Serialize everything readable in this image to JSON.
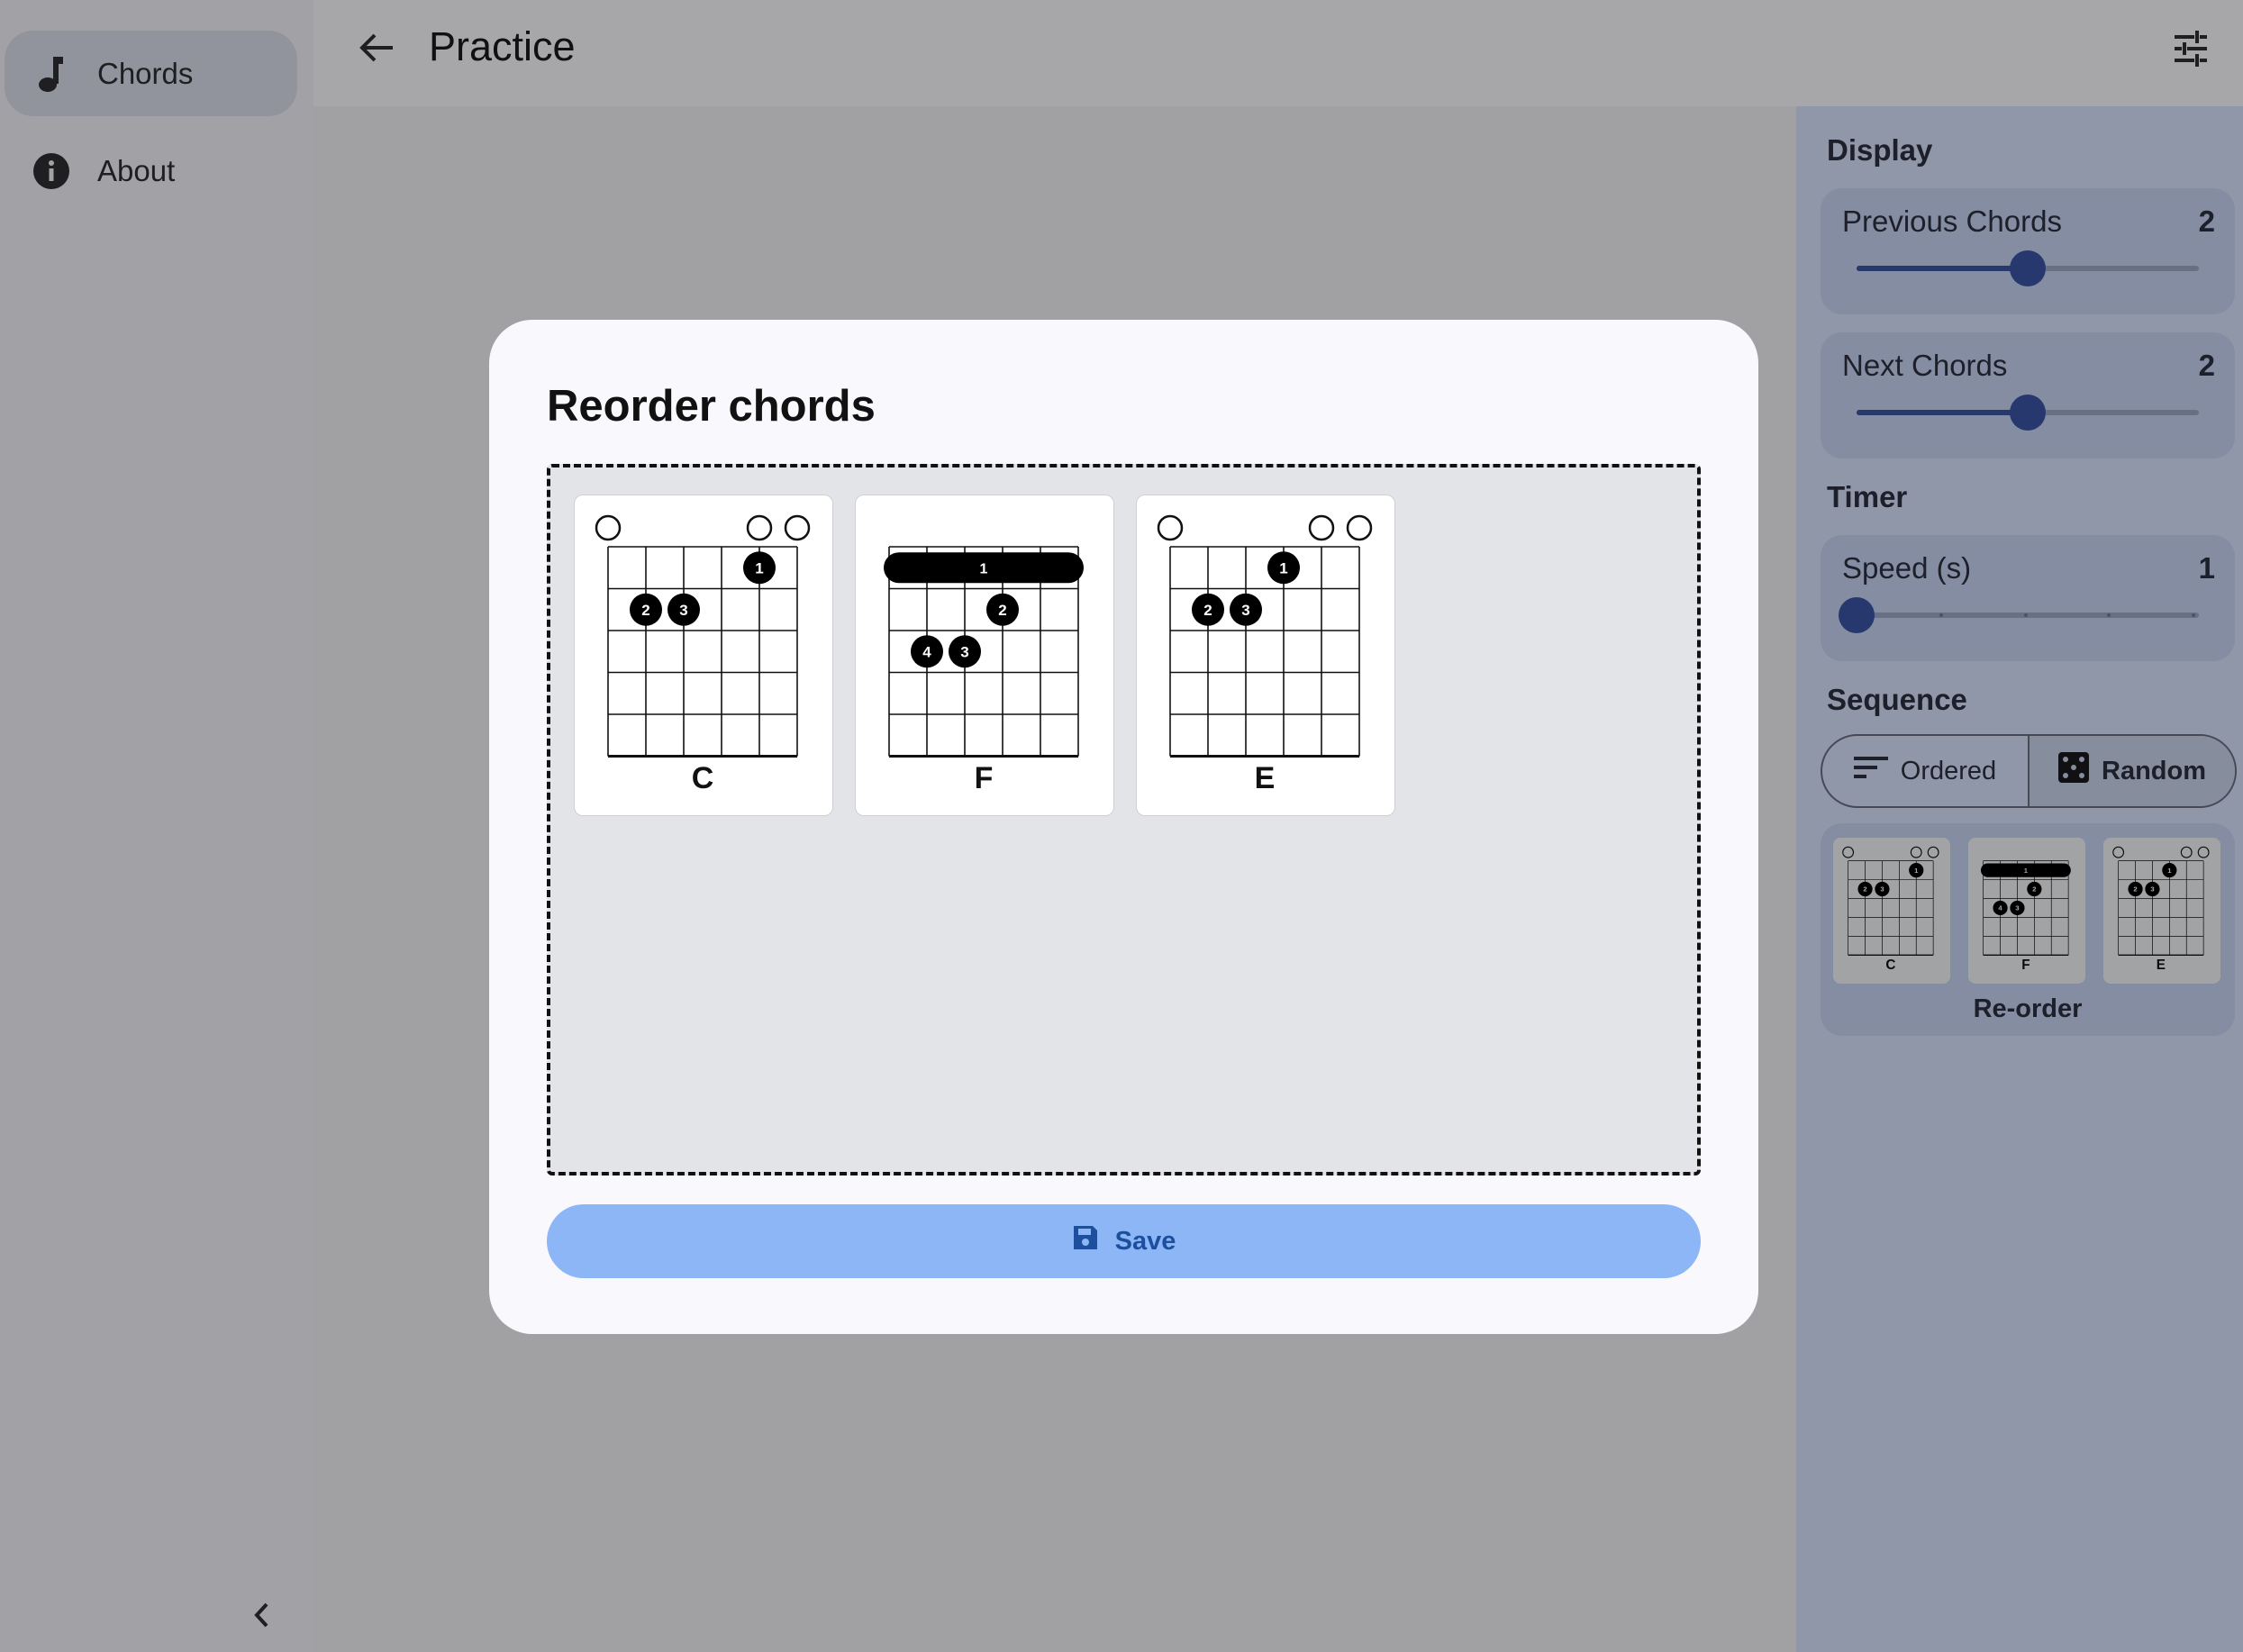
{
  "nav": {
    "items": [
      {
        "label": "Chords",
        "icon": "music-note-icon",
        "active": true
      },
      {
        "label": "About",
        "icon": "info-icon",
        "active": false
      }
    ]
  },
  "appbar": {
    "title": "Practice"
  },
  "panel": {
    "display_title": "Display",
    "previous": {
      "label": "Previous Chords",
      "value": "2",
      "fraction": 0.5
    },
    "next": {
      "label": "Next Chords",
      "value": "2",
      "fraction": 0.5
    },
    "timer_title": "Timer",
    "speed": {
      "label": "Speed (s)",
      "value": "1",
      "fraction": 0.0
    },
    "sequence_title": "Sequence",
    "sequence_options": [
      "Ordered",
      "Random"
    ],
    "sequence_selected": "Random",
    "reorder_label": "Re-order"
  },
  "dialog": {
    "title": "Reorder chords",
    "save_label": "Save",
    "chords": [
      {
        "name": "C",
        "open": [
          1,
          5,
          6
        ],
        "barre": null,
        "dots": [
          {
            "string": 5,
            "fret": 1,
            "finger": "1"
          },
          {
            "string": 2,
            "fret": 2,
            "finger": "2"
          },
          {
            "string": 3,
            "fret": 2,
            "finger": "3"
          }
        ]
      },
      {
        "name": "F",
        "open": [],
        "barre": {
          "fret": 1,
          "finger": "1"
        },
        "dots": [
          {
            "string": 4,
            "fret": 2,
            "finger": "2"
          },
          {
            "string": 2,
            "fret": 3,
            "finger": "4"
          },
          {
            "string": 3,
            "fret": 3,
            "finger": "3"
          }
        ]
      },
      {
        "name": "E",
        "open": [
          1,
          5,
          6
        ],
        "barre": null,
        "dots": [
          {
            "string": 4,
            "fret": 1,
            "finger": "1"
          },
          {
            "string": 2,
            "fret": 2,
            "finger": "2"
          },
          {
            "string": 3,
            "fret": 2,
            "finger": "3"
          }
        ]
      }
    ]
  }
}
